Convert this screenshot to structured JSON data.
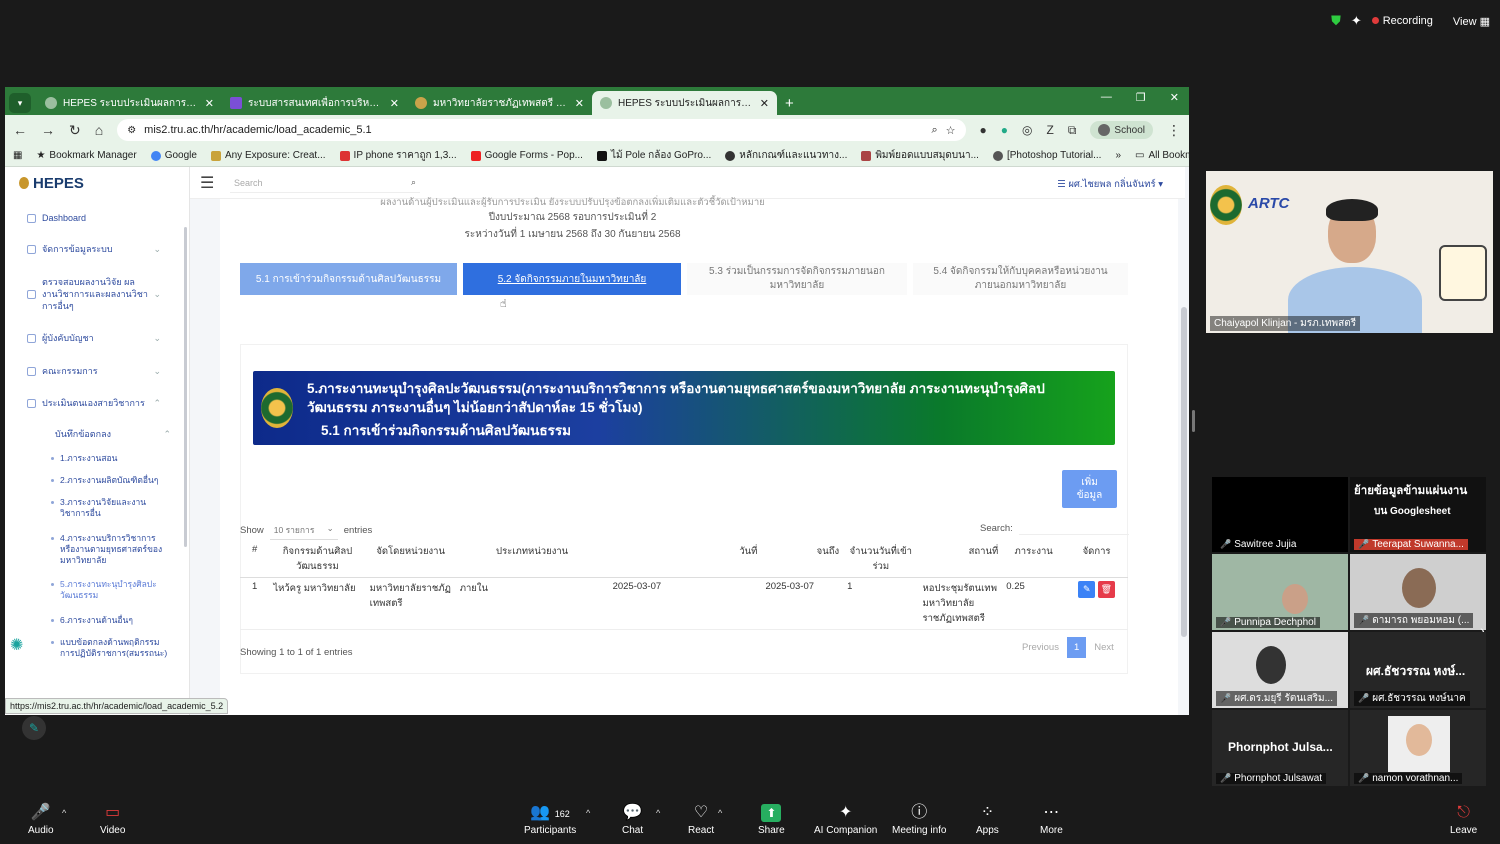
{
  "zoom_top": {
    "recording": "Recording",
    "view": "View"
  },
  "browser": {
    "tabs": [
      {
        "title": "HEPES ระบบประเมินผลการปฏิบัติงาน"
      },
      {
        "title": "ระบบสารสนเทศเพื่อการบริหาร MIST"
      },
      {
        "title": "มหาวิทยาลัยราชภัฏเทพสตรี Thepsa"
      },
      {
        "title": "HEPES ระบบประเมินผลการปฏิบัติงาน"
      }
    ],
    "url": "mis2.tru.ac.th/hr/academic/load_academic_5.1",
    "profile": "School",
    "bookmarks": [
      "Bookmark Manager",
      "Google",
      "Any Exposure: Creat...",
      "IP phone ราคาถูก 1,3...",
      "Google Forms - Pop...",
      "ไม้ Pole กล้อง GoPro...",
      "หลักเกณฑ์และแนวทาง...",
      "พิมพ์ยอดแบบสมุดบนา...",
      "[Photoshop Tutorial..."
    ],
    "all_bookmarks": "All Bookmarks",
    "status_url": "https://mis2.tru.ac.th/hr/academic/load_academic_5.2"
  },
  "app": {
    "brand": "HEPES",
    "search_placeholder": "Search",
    "user": "ผศ.ไชยพล กลิ่นจันทร์",
    "nav": [
      {
        "label": "Dashboard"
      },
      {
        "label": "จัดการข้อมูลระบบ"
      },
      {
        "label": "ตรวจสอบผลงานวิจัย ผลงานวิชาการและผลงานวิชาการอื่นๆ"
      },
      {
        "label": "ผู้บังคับบัญชา"
      },
      {
        "label": "คณะกรรมการ"
      },
      {
        "label": "ประเมินตนเองสายวิชาการ"
      },
      {
        "label": "บันทึกข้อตกลง"
      }
    ],
    "subnav": [
      "1.ภาระงานสอน",
      "2.ภาระงานผลิตบัณฑิตอื่นๆ",
      "3.ภาระงานวิจัยและงานวิชาการอื่น",
      "4.ภาระงานบริการวิชาการ หรืองานตามยุทธศาสตร์ของมหาวิทยาลัย",
      "5.ภาระงานทะนุบำรุงศิลปะวัฒนธรรม",
      "6.ภาระงานด้านอื่นๆ",
      "แบบข้อตกลงด้านพฤติกรรมการปฏิบัติราชการ(สมรรถนะ)"
    ],
    "header_lines": [
      "ผลงานด้านผู้ประเมินและผู้รับการประเมิน ยังระบบปรับปรุงข้อตกลงเพิ่มเติมและตัวชี้วัดเป้าหมาย",
      "ปีงบประมาณ 2568 รอบการประเมินที่ 2",
      "ระหว่างวันที่ 1 เมษายน 2568 ถึง 30 กันยายน 2568"
    ],
    "subtabs": [
      "5.1 การเข้าร่วมกิจกรรมด้านศิลปวัฒนธรรม",
      "5.2 จัดกิจกรรมภายในมหาวิทยาลัย",
      "5.3 ร่วมเป็นกรรมการจัดกิจกรรมภายนอกมหาวิทยาลัย",
      "5.4 จัดกิจกรรมให้กับบุคคลหรือหน่วยงานภายนอกมหาวิทยาลัย"
    ],
    "banner_title": "5.ภาระงานทะนุบำรุงศิลปะวัฒนธรรม(ภาระงานบริการวิชาการ หรืองานตามยุทธศาสตร์ของมหาวิทยาลัย ภาระงานทะนุบำรุงศิลปวัฒนธรรม ภาระงานอื่นๆ ไม่น้อยกว่าสัปดาห์ละ 15 ชั่วโมง)",
    "banner_sub": "5.1 การเข้าร่วมกิจกรรมด้านศิลปวัฒนธรรม",
    "add_button": "เพิ่มข้อมูล",
    "show_label": "Show",
    "entries_select": "10 รายการ",
    "entries_label": "entries",
    "search_label": "Search:",
    "columns": [
      "#",
      "กิจกรรมด้านศิลปวัฒนธรรม",
      "จัดโดยหน่วยงาน",
      "ประเภทหน่วยงาน",
      "วันที่",
      "จนถึง",
      "จำนวนวันที่เข้าร่วม",
      "สถานที่",
      "ภาระงาน",
      "จัดการ"
    ],
    "rows": [
      [
        "1",
        "ไหว้ครู มหาวิทยาลัย",
        "มหาวิทยาลัยราชภัฏเทพสตรี",
        "ภายใน",
        "2025-03-07",
        "2025-03-07",
        "1",
        "หอประชุมรัตนเทพ มหาวิทยาลัยราชภัฏเทพสตรี",
        "0.25"
      ]
    ],
    "showing": "Showing 1 to 1 of 1 entries",
    "pager": {
      "prev": "Previous",
      "page": "1",
      "next": "Next"
    }
  },
  "participants": {
    "speaker": "Chaiyapol Klinjan - มรภ.เทพสตรี",
    "tiles": [
      {
        "name": "Sawitree Jujia"
      },
      {
        "name": "Teerapat Suwanna..."
      },
      {
        "name": "Punnipa Dechphol"
      },
      {
        "name": "ดามารถ พยอมหอม (..."
      },
      {
        "name": "ผศ.ดร.มยุรี รัตนเสริม..."
      },
      {
        "name": "ผศ.ธัชวรรณ หงษ์นาค"
      },
      {
        "name": "Phornphot Julsawat"
      },
      {
        "name": "namon vorathnan..."
      }
    ],
    "big_name_1": "ผศ.ธัชวรรณ หงษ์...",
    "big_name_2": "Phornphot  Julsa...",
    "share_text_1": "ย้ายข้อมูลข้ามแผ่นงาน",
    "share_text_2": "บน Googlesheet"
  },
  "toolbar": {
    "audio": "Audio",
    "video": "Video",
    "participants": "Participants",
    "participants_count": "162",
    "chat": "Chat",
    "react": "React",
    "share": "Share",
    "ai": "AI Companion",
    "meeting_info": "Meeting info",
    "apps": "Apps",
    "more": "More",
    "leave": "Leave"
  }
}
